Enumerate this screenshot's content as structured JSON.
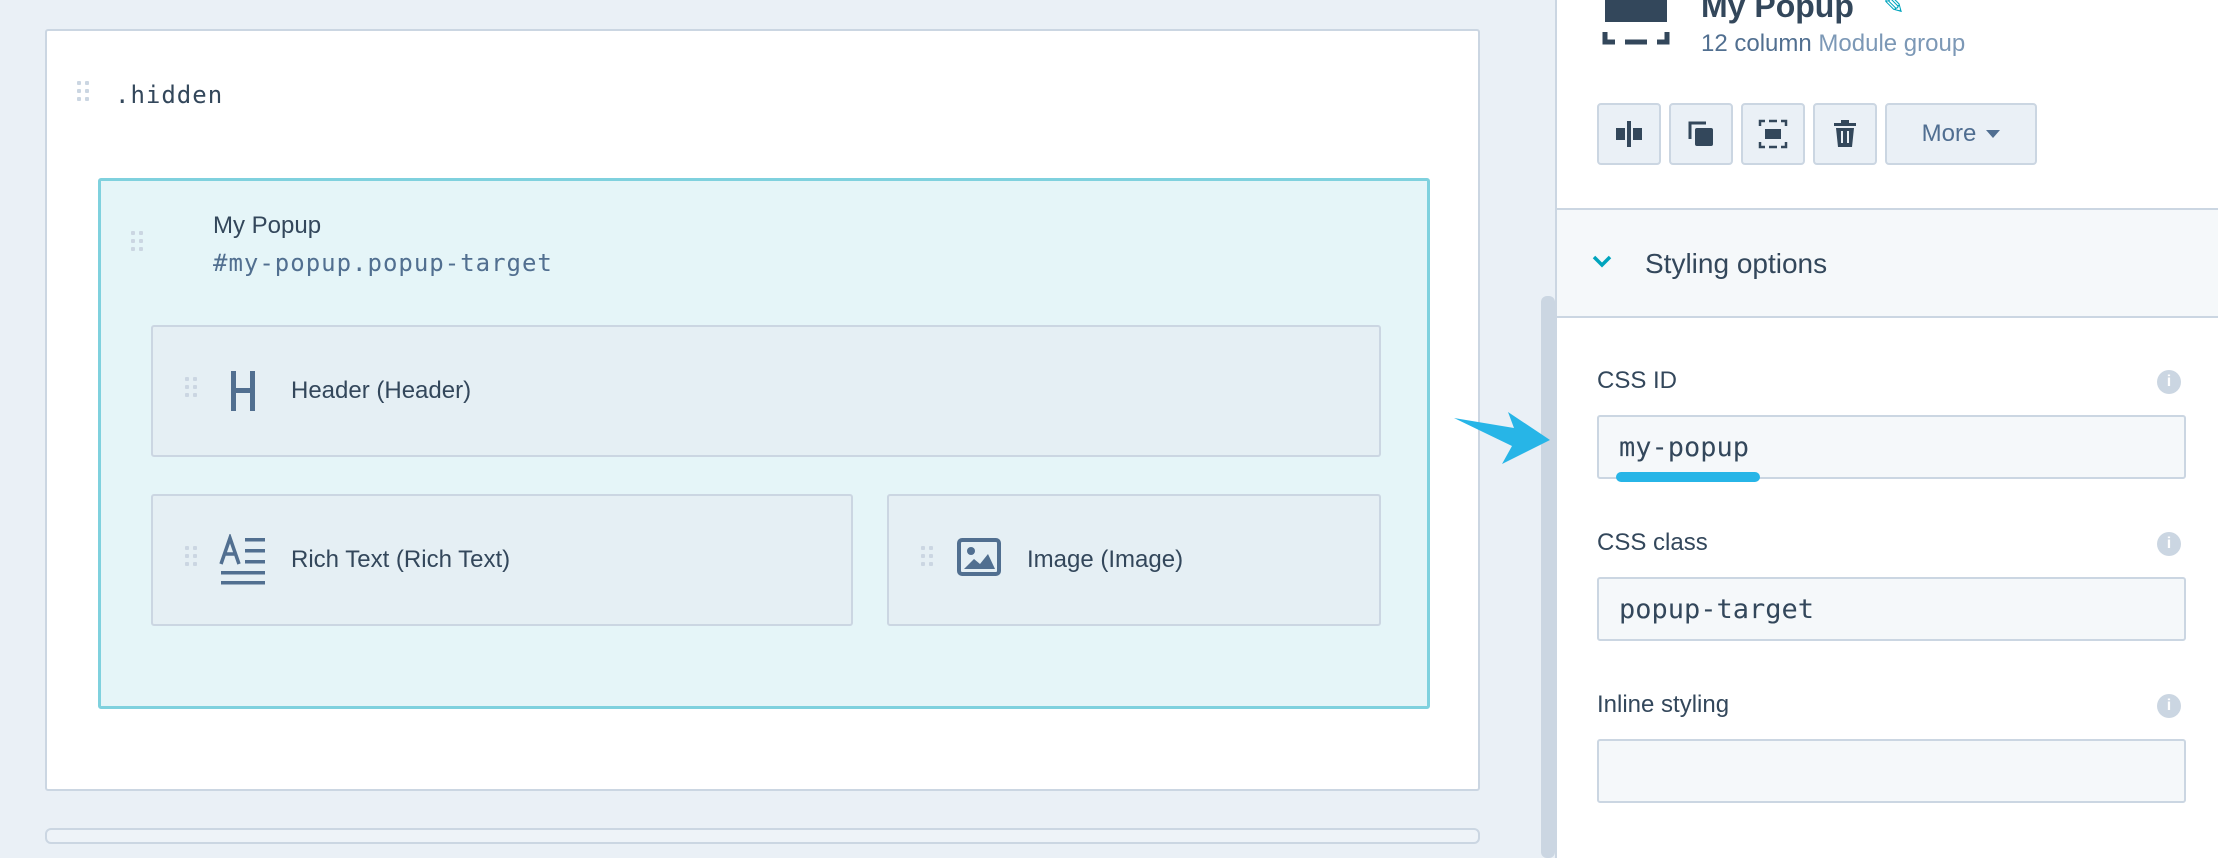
{
  "canvas": {
    "outer_group_label": ".hidden",
    "popup": {
      "title": "My Popup",
      "selector": "#my-popup.popup-target"
    },
    "modules": [
      {
        "label": "Header (Header)",
        "icon": "header-h-icon"
      },
      {
        "label": "Rich Text (Rich Text)",
        "icon": "rich-text-icon"
      },
      {
        "label": "Image (Image)",
        "icon": "image-icon"
      }
    ]
  },
  "sidebar": {
    "title": "My Popup",
    "subtitle_prefix": "12 column",
    "subtitle_link": "Module group",
    "toolbar": {
      "icons": [
        "split-column-icon",
        "clone-icon",
        "select-group-icon",
        "trash-icon"
      ],
      "more_label": "More"
    },
    "section": {
      "title": "Styling options"
    },
    "fields": {
      "css_id": {
        "label": "CSS ID",
        "value": "my-popup"
      },
      "css_class": {
        "label": "CSS class",
        "value": "popup-target"
      },
      "inline_styling": {
        "label": "Inline styling",
        "value": ""
      }
    }
  },
  "colors": {
    "accent": "#00a4bd",
    "popup_border": "#7fd1de",
    "popup_fill": "#e5f5f8",
    "callout_arrow": "#27b5e7"
  }
}
